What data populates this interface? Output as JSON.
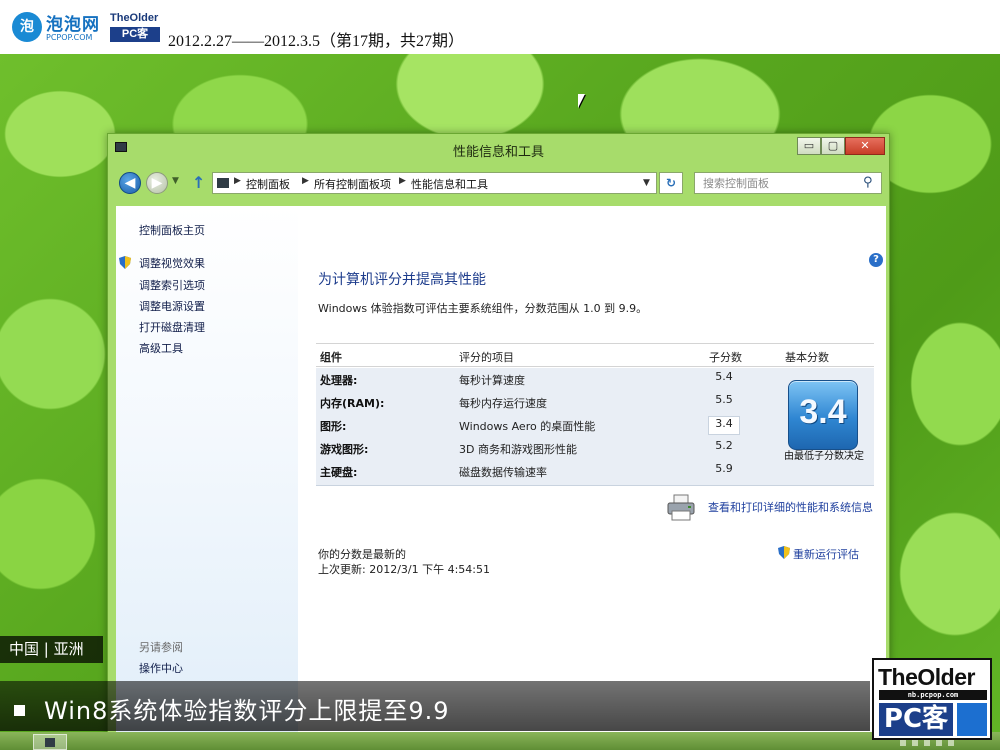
{
  "header": {
    "pcpop_logo_mark": "泡",
    "pcpop_name": "泡泡网",
    "pcpop_url": "PCPOP.COM",
    "theolder_small_top": "TheOlder",
    "theolder_small_pc": "PC客",
    "issue_text": "2012.2.27——2012.3.5（第17期，共27期）"
  },
  "window": {
    "title": "性能信息和工具",
    "controls": {
      "minimize": "▭",
      "maximize": "▢",
      "close": "✕"
    },
    "nav": {
      "back_glyph": "◀",
      "forward_glyph": "▶",
      "recent_glyph": "▼",
      "up_glyph": "↑"
    },
    "address": {
      "separator": "▶",
      "crumbs": [
        "控制面板",
        "所有控制面板项",
        "性能信息和工具"
      ],
      "dropdown_glyph": "▼",
      "refresh_glyph": "↻"
    },
    "search": {
      "placeholder": "搜索控制面板",
      "icon": "search-icon"
    },
    "leftnav": {
      "home": "控制面板主页",
      "links": [
        "调整视觉效果",
        "调整索引选项",
        "调整电源设置",
        "打开磁盘清理",
        "高级工具"
      ],
      "see_also_label": "另请参阅",
      "action_center": "操作中心"
    },
    "content": {
      "help_glyph": "?",
      "heading": "为计算机评分并提高其性能",
      "description": "Windows 体验指数可评估主要系统组件，分数范围从 1.0 到 9.9。",
      "table": {
        "headers": {
          "component": "组件",
          "rated_item": "评分的项目",
          "subscore": "子分数",
          "base_score": "基本分数"
        },
        "rows": [
          {
            "component": "处理器:",
            "item": "每秒计算速度",
            "score": "5.4"
          },
          {
            "component": "内存(RAM):",
            "item": "每秒内存运行速度",
            "score": "5.5"
          },
          {
            "component": "图形:",
            "item": "Windows Aero 的桌面性能",
            "score": "3.4"
          },
          {
            "component": "游戏图形:",
            "item": "3D 商务和游戏图形性能",
            "score": "5.2"
          },
          {
            "component": "主硬盘:",
            "item": "磁盘数据传输速率",
            "score": "5.9"
          }
        ],
        "lowest_row_index": 2
      },
      "base_score": "3.4",
      "base_caption": "由最低子分数决定",
      "print_link": "查看和打印详细的性能和系统信息",
      "status_line1": "你的分数是最新的",
      "status_line2": "上次更新: 2012/3/1 下午 4:54:51",
      "rerun_link": "重新运行评估"
    }
  },
  "overlay": {
    "region_label": "中国 | 亚洲",
    "caption": "Win8系统体验指数评分上限提至9.9",
    "big_logo_top": "TheOlder",
    "big_logo_url": "nb.pcpop.com",
    "big_logo_pc": "PC客"
  },
  "colors": {
    "link_blue": "#1e3f9e",
    "heading_blue": "#1d3c8c",
    "window_frame_green": "#a7dc6b",
    "close_red": "#c73d27",
    "badge_blue": "#2f86d2"
  }
}
